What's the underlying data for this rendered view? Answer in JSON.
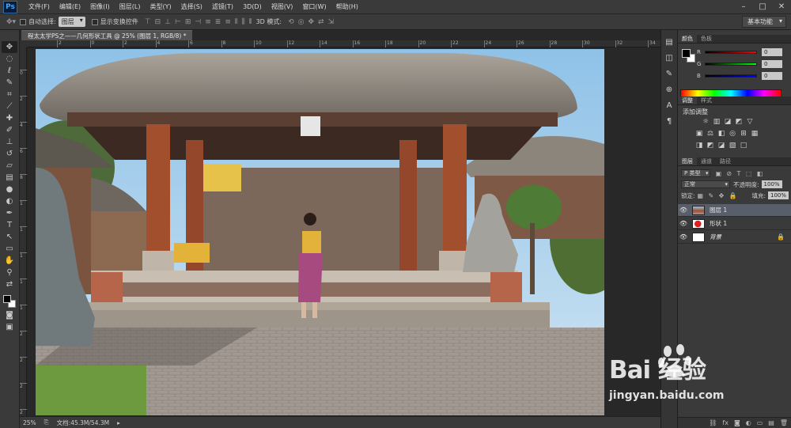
{
  "app": {
    "logo": "Ps"
  },
  "menu": [
    "文件(F)",
    "编辑(E)",
    "图像(I)",
    "图层(L)",
    "类型(Y)",
    "选择(S)",
    "滤镜(T)",
    "3D(D)",
    "视图(V)",
    "窗口(W)",
    "帮助(H)"
  ],
  "window_controls": [
    "–",
    "□",
    "✕"
  ],
  "options": {
    "auto_select_label": "自动选择:",
    "auto_select_value": "图层",
    "show_transform_label": "显示变换控件",
    "mode_3d_label": "3D 模式:",
    "workspace": "基本功能"
  },
  "document": {
    "tab_title": "程太太学PS之——几何形状工具 @ 25% (图层 1, RGB/8) *",
    "ruler_h": [
      "2",
      "0",
      "2",
      "4",
      "6",
      "8",
      "10",
      "12",
      "14",
      "16",
      "18",
      "20",
      "22",
      "24",
      "26",
      "28",
      "30",
      "32",
      "34"
    ],
    "ruler_v": [
      "0",
      "2",
      "4",
      "6",
      "8",
      "1",
      "1",
      "1",
      "1",
      "1",
      "2",
      "2",
      "2",
      "2"
    ]
  },
  "status": {
    "zoom": "25%",
    "doc_size": "文档:45.3M/54.3M"
  },
  "panels": {
    "color_tabs": [
      "颜色",
      "色板"
    ],
    "channels": [
      {
        "name": "R",
        "value": "0",
        "color": "#e03030"
      },
      {
        "name": "G",
        "value": "0",
        "color": "#30c030"
      },
      {
        "name": "B",
        "value": "0",
        "color": "#3050e0"
      }
    ],
    "adjust_tabs": [
      "调整",
      "样式"
    ],
    "adjust_title": "添加调整",
    "adjust_icons_row1": [
      "☼",
      "▥",
      "◪",
      "◩",
      "▽"
    ],
    "adjust_icons_row2": [
      "▣",
      "⚖",
      "◧",
      "◎",
      "⊞",
      "▦"
    ],
    "adjust_icons_row3": [
      "◨",
      "◩",
      "◪",
      "▧",
      "□"
    ],
    "layers_tabs": [
      "图层",
      "通道",
      "路径"
    ],
    "kind_filter": "P 类型",
    "filter_icons": [
      "▣",
      "⊘",
      "T",
      "⬚",
      "◧"
    ],
    "blend_mode": "正常",
    "opacity_label": "不透明度:",
    "opacity_value": "100%",
    "lock_label": "锁定:",
    "lock_icons": [
      "▦",
      "✎",
      "✥",
      "🔒"
    ],
    "fill_label": "填充:",
    "fill_value": "100%",
    "layers": [
      {
        "name": "图层 1",
        "selected": true,
        "lock": ""
      },
      {
        "name": "形状 1",
        "selected": false,
        "lock": ""
      },
      {
        "name": "背景",
        "selected": false,
        "lock": "🔒"
      }
    ],
    "footer_icons": [
      "⛓",
      "fx",
      "◙",
      "◐",
      "▭",
      "▤",
      "🗑"
    ]
  },
  "watermark": {
    "brand": "Bai  经验",
    "url": "jingyan.baidu.com"
  }
}
